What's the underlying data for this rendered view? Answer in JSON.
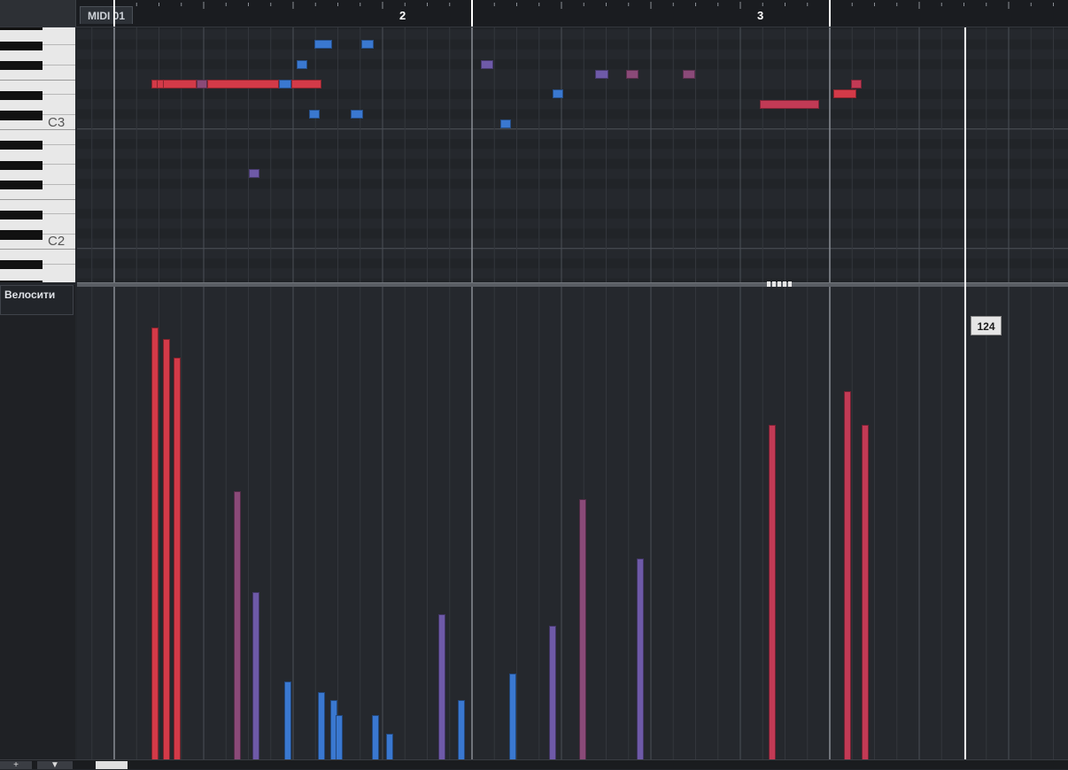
{
  "ruler": {
    "part_label": "MIDI 01",
    "bar_2": "2",
    "bar_3": "3"
  },
  "keyboard": {
    "label_c3": "C3",
    "label_c2": "C2"
  },
  "lane": {
    "title": "Велосити",
    "readout": "124"
  },
  "bottom_bar": {
    "add_label": "+",
    "menu_label": "▼"
  },
  "colors": {
    "red": "#d33a48",
    "crimson": "#c23a55",
    "purple": "#6e5aa8",
    "mauve": "#8a4a78",
    "blue": "#3a78d0"
  },
  "notes": [
    {
      "start": 0.105,
      "len": 0.015,
      "pitch": 64,
      "color": "red"
    },
    {
      "start": 0.12,
      "len": 0.015,
      "pitch": 64,
      "color": "red"
    },
    {
      "start": 0.135,
      "len": 0.095,
      "pitch": 64,
      "color": "red"
    },
    {
      "start": 0.23,
      "len": 0.03,
      "pitch": 64,
      "color": "mauve"
    },
    {
      "start": 0.26,
      "len": 0.2,
      "pitch": 64,
      "color": "red"
    },
    {
      "start": 0.46,
      "len": 0.035,
      "pitch": 64,
      "color": "blue"
    },
    {
      "start": 0.495,
      "len": 0.085,
      "pitch": 64,
      "color": "red"
    },
    {
      "start": 0.375,
      "len": 0.03,
      "pitch": 55,
      "color": "purple"
    },
    {
      "start": 0.51,
      "len": 0.03,
      "pitch": 66,
      "color": "blue"
    },
    {
      "start": 0.545,
      "len": 0.03,
      "pitch": 61,
      "color": "blue"
    },
    {
      "start": 0.56,
      "len": 0.05,
      "pitch": 68,
      "color": "blue"
    },
    {
      "start": 0.66,
      "len": 0.035,
      "pitch": 61,
      "color": "blue"
    },
    {
      "start": 0.69,
      "len": 0.035,
      "pitch": 68,
      "color": "blue"
    },
    {
      "start": 1.025,
      "len": 0.035,
      "pitch": 66,
      "color": "purple"
    },
    {
      "start": 1.08,
      "len": 0.03,
      "pitch": 60,
      "color": "blue"
    },
    {
      "start": 1.225,
      "len": 0.03,
      "pitch": 63,
      "color": "blue"
    },
    {
      "start": 1.345,
      "len": 0.035,
      "pitch": 65,
      "color": "purple"
    },
    {
      "start": 1.43,
      "len": 0.035,
      "pitch": 65,
      "color": "mauve"
    },
    {
      "start": 1.59,
      "len": 0.035,
      "pitch": 65,
      "color": "mauve"
    },
    {
      "start": 1.805,
      "len": 0.165,
      "pitch": 62,
      "color": "crimson"
    },
    {
      "start": 2.01,
      "len": 0.065,
      "pitch": 63,
      "color": "red"
    },
    {
      "start": 2.06,
      "len": 0.03,
      "pitch": 64,
      "color": "crimson"
    }
  ],
  "velocities": [
    {
      "pos": 0.105,
      "value": 116,
      "color": "red"
    },
    {
      "pos": 0.135,
      "value": 113,
      "color": "red"
    },
    {
      "pos": 0.165,
      "value": 108,
      "color": "red"
    },
    {
      "pos": 0.335,
      "value": 72,
      "color": "mauve"
    },
    {
      "pos": 0.385,
      "value": 45,
      "color": "purple"
    },
    {
      "pos": 0.475,
      "value": 21,
      "color": "blue"
    },
    {
      "pos": 0.57,
      "value": 18,
      "color": "blue"
    },
    {
      "pos": 0.605,
      "value": 16,
      "color": "blue"
    },
    {
      "pos": 0.62,
      "value": 12,
      "color": "blue"
    },
    {
      "pos": 0.72,
      "value": 12,
      "color": "blue"
    },
    {
      "pos": 0.76,
      "value": 7,
      "color": "blue"
    },
    {
      "pos": 0.905,
      "value": 39,
      "color": "purple"
    },
    {
      "pos": 0.96,
      "value": 16,
      "color": "blue"
    },
    {
      "pos": 1.105,
      "value": 23,
      "color": "blue"
    },
    {
      "pos": 1.215,
      "value": 36,
      "color": "purple"
    },
    {
      "pos": 1.3,
      "value": 70,
      "color": "mauve"
    },
    {
      "pos": 1.46,
      "value": 54,
      "color": "purple"
    },
    {
      "pos": 1.83,
      "value": 90,
      "color": "crimson"
    },
    {
      "pos": 2.04,
      "value": 99,
      "color": "crimson"
    },
    {
      "pos": 2.09,
      "value": 90,
      "color": "crimson"
    }
  ]
}
